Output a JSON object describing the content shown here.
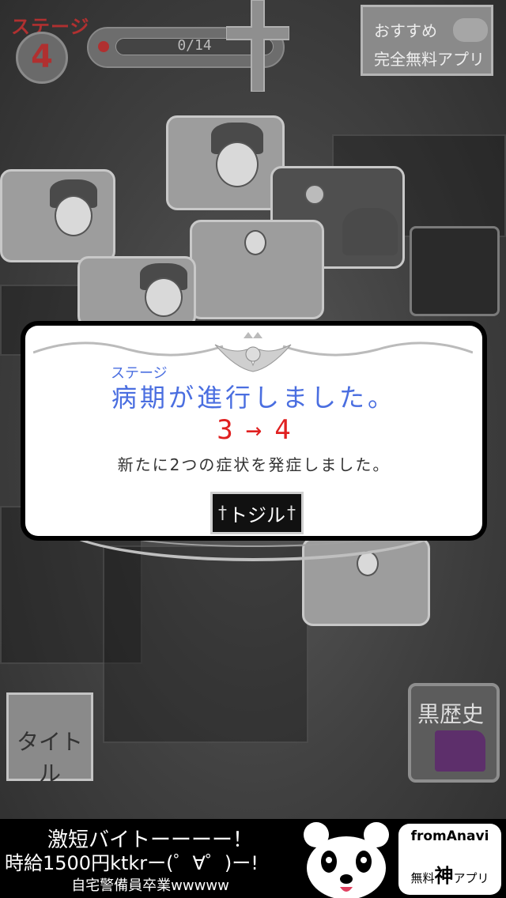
{
  "hud": {
    "stage_label": "ステージ",
    "stage_number": "4",
    "progress_text": "0/14",
    "recommend_line1": "おすすめ",
    "recommend_line2": "完全無料アプリ"
  },
  "dialog": {
    "ruby": "ステージ",
    "title": "病期が進行しました。",
    "stage_from": "3",
    "arrow": "→",
    "stage_to": "4",
    "message": "新たに2つの症状を発症しました。",
    "close_label": "トジル"
  },
  "buttons": {
    "title_label": "タイトル",
    "history_label": "黒歴史"
  },
  "ad": {
    "line1": "激短バイトーーーー！",
    "line2": "時給1500円ktkrー(゜∀゜)ー!",
    "line3": "自宅警備員卒業wwwww",
    "brand_name": "fromAnavi",
    "brand_sub_prefix": "無料",
    "brand_sub_big": "神",
    "brand_sub_suffix": "アプリ"
  },
  "colors": {
    "accent_blue": "#4a6ee0",
    "accent_red": "#e02020",
    "stage_red": "#b03030"
  }
}
